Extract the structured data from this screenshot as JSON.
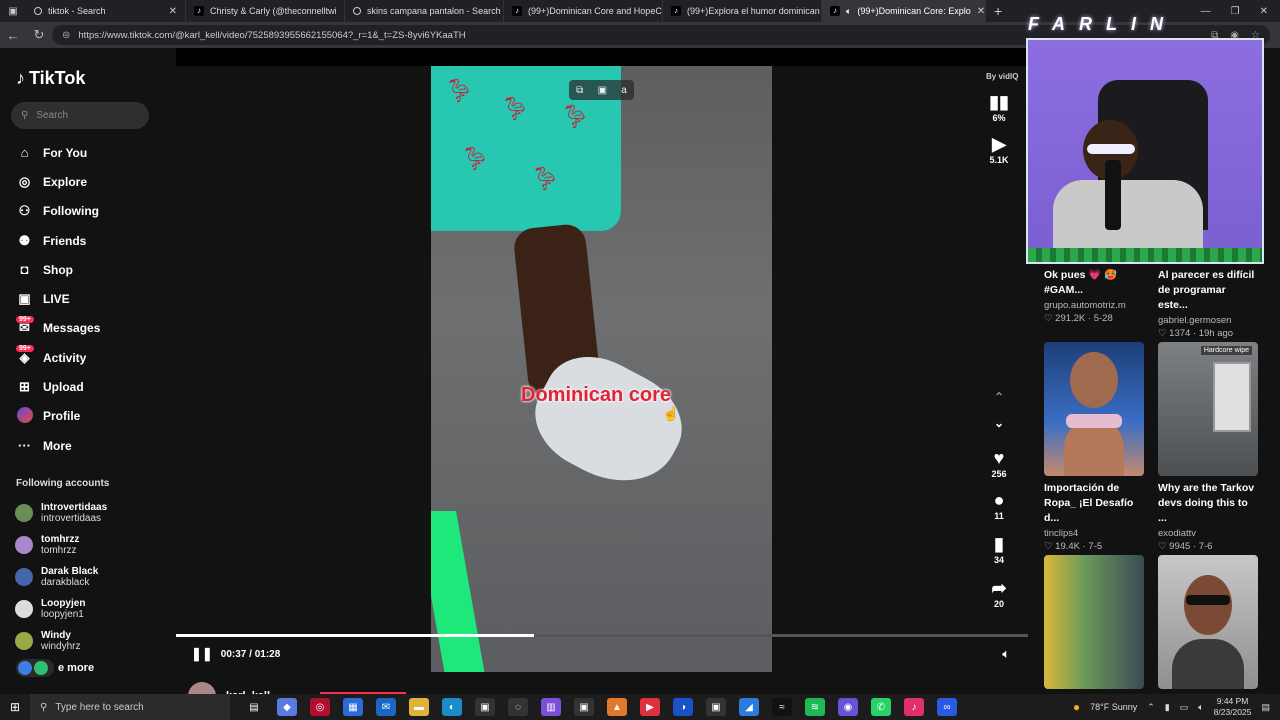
{
  "browser": {
    "tabs": [
      {
        "title": "tiktok - Search",
        "icon": "search-icon"
      },
      {
        "title": "Christy & Carly (@theconnelltwi",
        "icon": "tiktok-icon"
      },
      {
        "title": "skins campana pantalon - Search",
        "icon": "search-icon"
      },
      {
        "title": "(99+)Dominican Core and HopeC",
        "icon": "tiktok-icon"
      },
      {
        "title": "(99+)Explora el humor dominican",
        "icon": "tiktok-icon"
      },
      {
        "title": "(99+)Dominican Core: Explo",
        "icon": "tiktok-icon",
        "active": true
      }
    ],
    "url": "https://www.tiktok.com/@karl_kell/video/7525893955662155064?_r=1&_t=ZS-8yvi6YKaaTH"
  },
  "sidebar": {
    "logo": "TikTok",
    "search_placeholder": "Search",
    "nav": [
      {
        "label": "For You",
        "icon": "home-icon",
        "glyph": "⌂"
      },
      {
        "label": "Explore",
        "icon": "compass-icon",
        "glyph": "◎"
      },
      {
        "label": "Following",
        "icon": "following-icon",
        "glyph": "⚇"
      },
      {
        "label": "Friends",
        "icon": "friends-icon",
        "glyph": "⚉"
      },
      {
        "label": "Shop",
        "icon": "shop-icon",
        "glyph": "◘"
      },
      {
        "label": "LIVE",
        "icon": "live-icon",
        "glyph": "▣"
      },
      {
        "label": "Messages",
        "icon": "messages-icon",
        "glyph": "✉",
        "badge": "99+"
      },
      {
        "label": "Activity",
        "icon": "activity-icon",
        "glyph": "◈",
        "badge": "99+"
      },
      {
        "label": "Upload",
        "icon": "upload-icon",
        "glyph": "⊞"
      },
      {
        "label": "Profile",
        "icon": "profile-icon",
        "glyph": "●"
      },
      {
        "label": "More",
        "icon": "more-icon",
        "glyph": "···"
      }
    ],
    "following_title": "Following accounts",
    "accounts": [
      {
        "name": "Introvertidaas",
        "handle": "introvertidaas",
        "color": "#6a8e5a"
      },
      {
        "name": "tomhrzz",
        "handle": "tomhrzz",
        "color": "#aa88cc"
      },
      {
        "name": "Darak Black",
        "handle": "darakblack",
        "color": "#4466aa"
      },
      {
        "name": "Loopyjen",
        "handle": "loopyjen1",
        "color": "#dddddd"
      },
      {
        "name": "Windy",
        "handle": "windyhrz",
        "color": "#99aa44"
      }
    ],
    "see_more": "e more"
  },
  "video": {
    "caption": "Dominican core",
    "time": "00:37 / 01:28",
    "progress_fraction": 0.42,
    "vidiq_label": "By vidIQ",
    "vidiq_percent": "6%",
    "views": "5.1K",
    "likes": "256",
    "comments": "11",
    "saves": "34",
    "shares": "20",
    "author": "karl_kell"
  },
  "overlay": {
    "farlin": "FARLIN"
  },
  "recommendations": [
    {
      "title": "Ok pues 💗 🥵 #GAM...",
      "user": "grupo.automotriz.m",
      "stats": "♡ 291.2K · 5-28"
    },
    {
      "title": "Al parecer es difícil de programar este...",
      "user": "gabriel.germosen",
      "stats": "♡ 1374 · 19h ago"
    },
    {
      "title": "Importación de Ropa_ ¡El Desafío d...",
      "user": "tinclips4",
      "stats": "♡ 19.4K · 7-5",
      "thumb_label": ""
    },
    {
      "title": "Why are the Tarkov devs doing this to ...",
      "user": "exodiattv",
      "stats": "♡ 9945 · 7-6",
      "thumb_label": "Hardcore wipe"
    }
  ],
  "taskbar": {
    "search_placeholder": "Type here to search",
    "weather": "78°F  Sunny",
    "time": "9:44 PM",
    "date": "8/23/2025"
  }
}
